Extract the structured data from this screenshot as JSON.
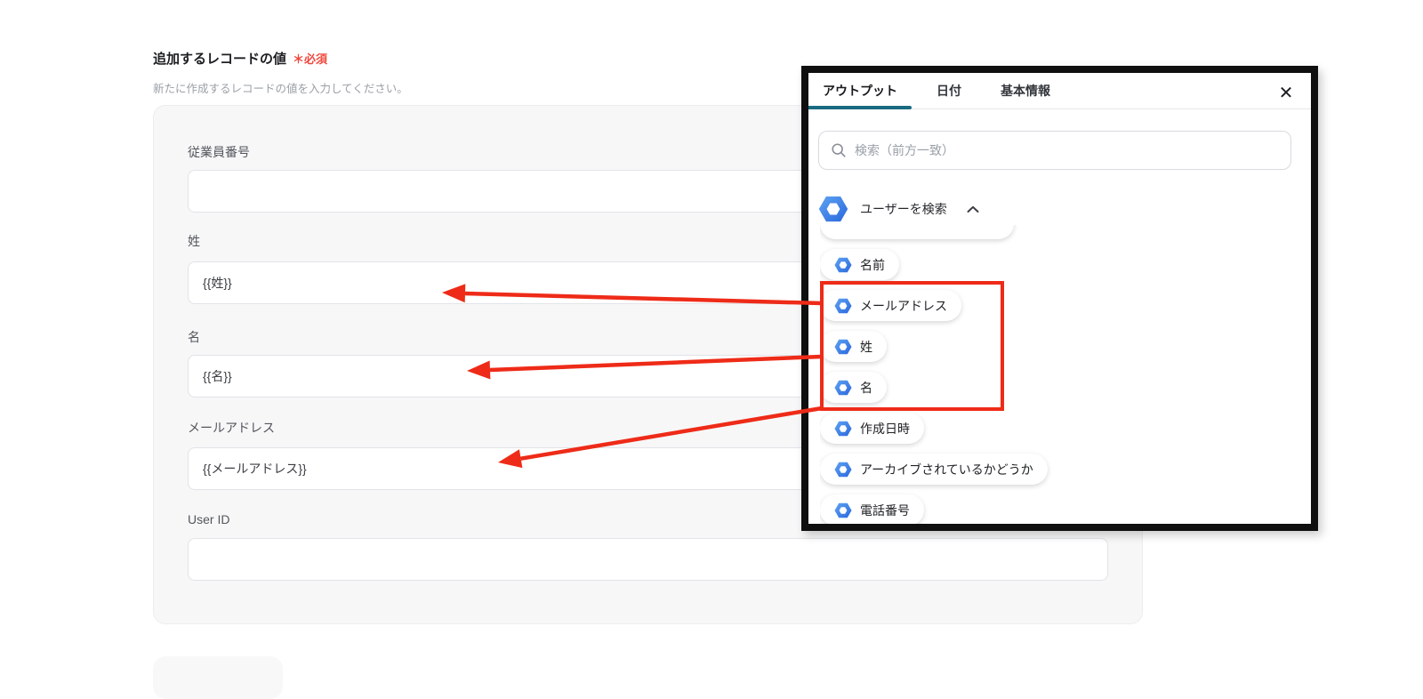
{
  "header": {
    "title": "追加するレコードの値",
    "required_badge": "＊必須",
    "subtitle": "新たに作成するレコードの値を入力してください。"
  },
  "form": {
    "fields": [
      {
        "label": "従業員番号",
        "value": ""
      },
      {
        "label": "姓",
        "value": "{{姓}}"
      },
      {
        "label": "名",
        "value": "{{名}}"
      },
      {
        "label": "メールアドレス",
        "value": "{{メールアドレス}}"
      },
      {
        "label": "User ID",
        "value": ""
      }
    ]
  },
  "panel": {
    "tabs": [
      {
        "label": "アウトプット",
        "active": true
      },
      {
        "label": "日付",
        "active": false
      },
      {
        "label": "基本情報",
        "active": false
      }
    ],
    "close_icon": "✕",
    "search_placeholder": "検索（前方一致）",
    "section_label": "ユーザーを検索",
    "items": [
      {
        "label": "名前"
      },
      {
        "label": "メールアドレス"
      },
      {
        "label": "姓"
      },
      {
        "label": "名"
      },
      {
        "label": "作成日時"
      },
      {
        "label": "アーカイブされているかどうか"
      },
      {
        "label": "電話番号"
      }
    ]
  },
  "colors": {
    "tab_underline_teal": "#186b80",
    "hexagon_blue_light": "#5ea4f2",
    "hexagon_blue_dark": "#2a67dd",
    "annotation_red": "#ee2b18",
    "required_red": "#f0483e"
  }
}
